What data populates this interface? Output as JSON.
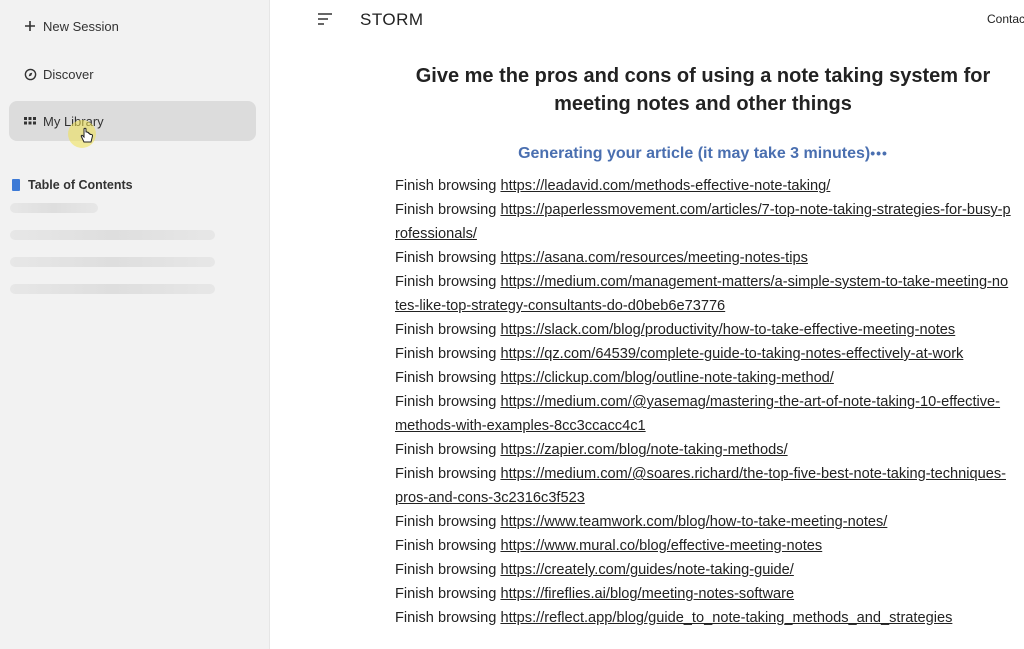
{
  "sidebar": {
    "new_session": "New Session",
    "discover": "Discover",
    "my_library": "My Library",
    "toc_title": "Table of Contents"
  },
  "header": {
    "brand": "STORM",
    "contact": "Contac"
  },
  "main": {
    "title": "Give me the pros and cons of using a note taking system for meeting notes and other things",
    "status": "Generating your article (it may take 3 minutes)",
    "status_dots": "•••",
    "log_prefix": "Finish browsing",
    "urls": [
      "https://leadavid.com/methods-effective-note-taking/",
      "https://paperlessmovement.com/articles/7-top-note-taking-strategies-for-busy-professionals/",
      "https://asana.com/resources/meeting-notes-tips",
      "https://medium.com/management-matters/a-simple-system-to-take-meeting-notes-like-top-strategy-consultants-do-d0beb6e73776",
      "https://slack.com/blog/productivity/how-to-take-effective-meeting-notes",
      "https://qz.com/64539/complete-guide-to-taking-notes-effectively-at-work",
      "https://clickup.com/blog/outline-note-taking-method/",
      "https://medium.com/@yasemag/mastering-the-art-of-note-taking-10-effective-methods-with-examples-8cc3ccacc4c1",
      "https://zapier.com/blog/note-taking-methods/",
      "https://medium.com/@soares.richard/the-top-five-best-note-taking-techniques-pros-and-cons-3c2316c3f523",
      "https://www.teamwork.com/blog/how-to-take-meeting-notes/",
      "https://www.mural.co/blog/effective-meeting-notes",
      "https://creately.com/guides/note-taking-guide/",
      "https://fireflies.ai/blog/meeting-notes-software",
      "https://reflect.app/blog/guide_to_note-taking_methods_and_strategies"
    ]
  },
  "colors": {
    "sidebar_bg": "#f2f2f2",
    "active_item_bg": "#dcdcdc",
    "status_blue": "#4a6fb0",
    "toc_icon_blue": "#3d7ad6"
  },
  "icons": {
    "new_session": "plus-icon",
    "discover": "compass-icon",
    "my_library": "grid-icon",
    "toc": "book-icon",
    "menu": "menu-icon"
  }
}
